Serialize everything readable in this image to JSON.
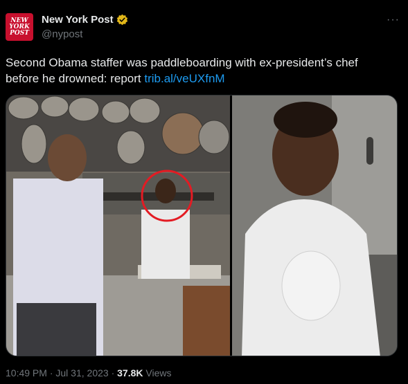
{
  "account": {
    "logo_lines": [
      "NEW",
      "YORK",
      "POST"
    ],
    "display_name": "New York Post",
    "handle": "@nypost",
    "verified_icon": "gold-verified-badge-icon",
    "more_label": "···"
  },
  "tweet": {
    "text": "Second Obama staffer was paddleboarding with ex-president’s chef before he drowned: report ",
    "link_text": "trib.al/veUXfnM"
  },
  "meta": {
    "time": "10:49 PM",
    "separator": " · ",
    "date": "Jul 31, 2023",
    "views_count": "37.8K",
    "views_label": " Views"
  },
  "colors": {
    "link": "#1d9bf0",
    "secondary": "#71767b",
    "primary": "#e7e9ea",
    "brand_red": "#c8102e",
    "verified_gold": "#e2b719"
  }
}
